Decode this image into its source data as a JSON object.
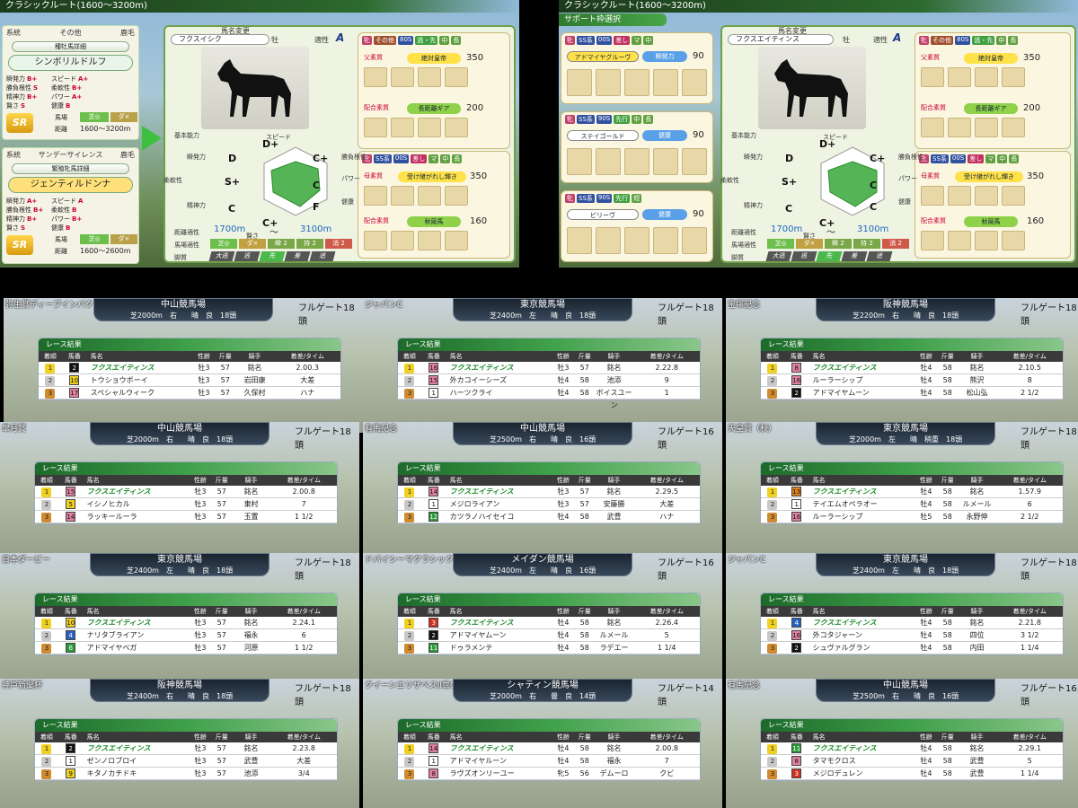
{
  "left_panel": {
    "header": "クラシックルート(1600～3200m)",
    "sire": {
      "cat1": "系統",
      "cat2": "その他",
      "coat": "鹿毛",
      "detail_btn": "種牡馬詳細",
      "name": "シンボリルドルフ",
      "stats": [
        [
          "瞬発力",
          "B+"
        ],
        [
          "スピード",
          "A+"
        ],
        [
          "勝負根性",
          "S"
        ],
        [
          "柔軟性",
          "B+"
        ],
        [
          "精神力",
          "B+"
        ],
        [
          "パワー",
          "A+"
        ],
        [
          "賢さ",
          "S"
        ],
        [
          "健康",
          "B"
        ]
      ],
      "surface": "芝◎",
      "surface2": "ダ×",
      "distance": "1600～3200m",
      "rank": "SR"
    },
    "dam": {
      "cat1": "系統",
      "cat2": "サンデーサイレンス",
      "coat": "鹿毛",
      "detail_btn": "繁殖牝馬詳細",
      "name": "ジェンティルドンナ",
      "stats": [
        [
          "瞬発力",
          "A+"
        ],
        [
          "スピード",
          "A"
        ],
        [
          "勝負根性",
          "B+"
        ],
        [
          "柔軟性",
          "B"
        ],
        [
          "精神力",
          "B+"
        ],
        [
          "パワー",
          "B+"
        ],
        [
          "賢さ",
          "S"
        ],
        [
          "健康",
          "B"
        ]
      ],
      "surface": "芝◎",
      "surface2": "ダ×",
      "distance": "1600～2600m",
      "rank": "SR"
    },
    "foal": {
      "rename": "馬名変更",
      "name": "フクスイシク",
      "sex": "牡",
      "aptitude_label": "適性",
      "aptitude": "A",
      "basic": "基本能力",
      "grades": {
        "speed": "D+",
        "guts": "C+",
        "power": "C",
        "health": "F",
        "int": "C+",
        "mind": "C",
        "flex": "S+",
        "burst": "D"
      },
      "stat_labels": {
        "speed": "スピード",
        "guts": "勝負根性",
        "power": "パワー",
        "health": "健康",
        "int": "賢さ",
        "mind": "精神力",
        "flex": "柔軟性",
        "burst": "瞬発力"
      },
      "dist_label": "距離適性",
      "dist_from": "1700m",
      "dist_sep": "～",
      "dist_to": "3100m",
      "ground_label": "馬場適性",
      "ground": [
        "芝◎",
        "ダ×",
        "瞬 2",
        "持 2",
        "消 2"
      ],
      "leg_label": "脚質",
      "legs": [
        "大逃",
        "逃",
        "先",
        "差",
        "追"
      ]
    },
    "skill_a": {
      "tags": [
        "牝",
        "その他",
        "80S",
        "逃・先",
        "中",
        "長"
      ],
      "group": "父素質",
      "skill1": "絶対皇帝",
      "pts1": "350",
      "group2": "配合素質",
      "skill2": "長距離ギア",
      "pts2": "200"
    },
    "skill_b": {
      "tags": [
        "牝",
        "SS系",
        "00S",
        "差し",
        "マ",
        "中",
        "長"
      ],
      "group": "母素質",
      "skill1": "受け継がれし輝き",
      "pts1": "350",
      "group2": "配合素質",
      "skill2": "秋競馬",
      "pts2": "160"
    }
  },
  "right_panel": {
    "header": "クラシックルート(1600～3200m)",
    "sub": "サポート枠選択",
    "supports": [
      {
        "tags": [
          "牝",
          "SS系",
          "00S",
          "差し",
          "マ",
          "中"
        ],
        "name": "アドマイヤグルーヴ",
        "skill": "瞬発力",
        "pts": "90"
      },
      {
        "tags": [
          "牝",
          "SS系",
          "90S",
          "先行",
          "中",
          "長"
        ],
        "name": "ステイゴールド",
        "skill": "健康",
        "pts": "90"
      },
      {
        "tags": [
          "牝",
          "SS系",
          "90S",
          "先行",
          "短"
        ],
        "name": "ビリーヴ",
        "skill": "健康",
        "pts": "90"
      }
    ],
    "foal_name": "フクスエイティンス",
    "foal_grades": {
      "speed": "D+",
      "guts": "C+",
      "power": "C",
      "health": "C",
      "int": "C+",
      "mind": "C",
      "flex": "S+",
      "burst": "D"
    },
    "dist_from": "1700m",
    "dist_to": "3100m"
  },
  "columns": [
    "着順",
    "馬番",
    "馬名",
    "性齢",
    "斤量",
    "騎手",
    "着差/タイム"
  ],
  "result_header": "レース結果",
  "races": [
    {
      "title": "弥生賞ディープインパクト記念",
      "track": "中山競馬場",
      "info": "芝2000m　右　　晴　良　18頭",
      "gate": "フルゲート18頭",
      "rows": [
        [
          "1",
          "2",
          "フクスエイティンス",
          "牡3",
          "57",
          "銘名",
          "2.00.3"
        ],
        [
          "2",
          "10",
          "トウショウボーイ",
          "牡3",
          "57",
          "岩田康",
          "大差"
        ],
        [
          "3",
          "17",
          "スペシャルウィーク",
          "牡3",
          "57",
          "久保村",
          "ハナ"
        ]
      ]
    },
    {
      "title": "ジャパンC",
      "track": "東京競馬場",
      "info": "芝2400m　左　　晴　良　18頭",
      "gate": "フルゲート18頭",
      "rows": [
        [
          "1",
          "16",
          "フクスエイティンス",
          "牡3",
          "57",
          "銘名",
          "2.22.8"
        ],
        [
          "2",
          "15",
          "外カコイーシーズ",
          "牡4",
          "58",
          "池添",
          "9"
        ],
        [
          "3",
          "1",
          "ハーツクライ",
          "牡4",
          "58",
          "ボイスユーン",
          "1"
        ]
      ]
    },
    {
      "title": "宝塚記念",
      "track": "阪神競馬場",
      "info": "芝2200m　右　　晴　良　18頭",
      "gate": "フルゲート18頭",
      "rows": [
        [
          "1",
          "8",
          "フクスエイティンス",
          "牡4",
          "58",
          "銘名",
          "2.10.5"
        ],
        [
          "2",
          "16",
          "ルーラーシップ",
          "牡4",
          "58",
          "熊沢",
          "8"
        ],
        [
          "3",
          "2",
          "アドマイヤムーン",
          "牡4",
          "58",
          "松山弘",
          "2 1/2"
        ]
      ]
    },
    {
      "title": "皐月賞",
      "track": "中山競馬場",
      "info": "芝2000m　右　　晴　良　18頭",
      "gate": "フルゲート18頭",
      "rows": [
        [
          "1",
          "15",
          "フクスエイティンス",
          "牡3",
          "57",
          "銘名",
          "2.00.8"
        ],
        [
          "2",
          "5",
          "イシノヒカル",
          "牡3",
          "57",
          "東村",
          "7"
        ],
        [
          "3",
          "14",
          "ラッキールーラ",
          "牡3",
          "57",
          "玉置",
          "1 1/2"
        ]
      ]
    },
    {
      "title": "有馬記念",
      "track": "中山競馬場",
      "info": "芝2500m　右　　晴　良　16頭",
      "gate": "フルゲート16頭",
      "rows": [
        [
          "1",
          "14",
          "フクスエイティンス",
          "牡3",
          "57",
          "銘名",
          "2.29.5"
        ],
        [
          "2",
          "1",
          "メジロライアン",
          "牡3",
          "57",
          "安藤勝",
          "大差"
        ],
        [
          "3",
          "12",
          "カツラノハイセイコ",
          "牡4",
          "58",
          "武豊",
          "ハナ"
        ]
      ]
    },
    {
      "title": "天皇賞（秋）",
      "track": "東京競馬場",
      "info": "芝2000m　左　　晴　稍重　18頭",
      "gate": "フルゲート18頭",
      "rows": [
        [
          "1",
          "13",
          "フクスエイティンス",
          "牡4",
          "58",
          "銘名",
          "1.57.9"
        ],
        [
          "2",
          "1",
          "テイエムオペラオー",
          "牡4",
          "58",
          "ルメール",
          "6"
        ],
        [
          "3",
          "16",
          "ルーラーシップ",
          "牡5",
          "58",
          "永野伸",
          "2 1/2"
        ]
      ]
    },
    {
      "title": "日本ダービー",
      "track": "東京競馬場",
      "info": "芝2400m　左　　晴　良　18頭",
      "gate": "フルゲート18頭",
      "rows": [
        [
          "1",
          "10",
          "フクスエイティンス",
          "牡3",
          "57",
          "銘名",
          "2.24.1"
        ],
        [
          "2",
          "4",
          "ナリタブライアン",
          "牡3",
          "57",
          "福永",
          "6"
        ],
        [
          "3",
          "6",
          "アドマイヤベガ",
          "牡3",
          "57",
          "河原",
          "1 1/2"
        ]
      ]
    },
    {
      "title": "ドバイシーマクラシック",
      "track": "メイダン競馬場",
      "info": "芝2400m　左　　晴　良　16頭",
      "gate": "フルゲート16頭",
      "rows": [
        [
          "1",
          "3",
          "フクスエイティンス",
          "牡4",
          "58",
          "銘名",
          "2.26.4"
        ],
        [
          "2",
          "2",
          "アドマイヤムーン",
          "牡4",
          "58",
          "ルメール",
          "5"
        ],
        [
          "3",
          "11",
          "ドゥラメンテ",
          "牡4",
          "58",
          "ラデエー",
          "1 1/4"
        ]
      ]
    },
    {
      "title": "ジャパンC",
      "track": "東京競馬場",
      "info": "芝2400m　左　　晴　良　18頭",
      "gate": "フルゲート18頭",
      "rows": [
        [
          "1",
          "4",
          "フクスエイティンス",
          "牡4",
          "58",
          "銘名",
          "2.21.8"
        ],
        [
          "2",
          "16",
          "外コタジャーン",
          "牡4",
          "58",
          "四位",
          "3 1/2"
        ],
        [
          "3",
          "2",
          "シュヴァルグラン",
          "牡4",
          "58",
          "内田",
          "1 1/4"
        ]
      ]
    },
    {
      "title": "神戸新聞杯",
      "track": "阪神競馬場",
      "info": "芝2400m　右　　晴　良　18頭",
      "gate": "フルゲート18頭",
      "rows": [
        [
          "1",
          "2",
          "フクスエイティンス",
          "牡3",
          "57",
          "銘名",
          "2.23.8"
        ],
        [
          "2",
          "1",
          "ゼンノロブロイ",
          "牡3",
          "57",
          "武豊",
          "大差"
        ],
        [
          "3",
          "9",
          "キタノカチドキ",
          "牡3",
          "57",
          "池添",
          "3/4"
        ]
      ]
    },
    {
      "title": "クイーンエリザベスII世C",
      "track": "シャティン競馬場",
      "info": "芝2000m　右　　曇　良　14頭",
      "gate": "フルゲート14頭",
      "rows": [
        [
          "1",
          "14",
          "フクスエイティンス",
          "牡4",
          "58",
          "銘名",
          "2.00.8"
        ],
        [
          "2",
          "1",
          "アドマイヤルーン",
          "牡4",
          "58",
          "福永",
          "7"
        ],
        [
          "3",
          "8",
          "ラヴズオンリーユー",
          "牝5",
          "56",
          "デムーロ",
          "クビ"
        ]
      ]
    },
    {
      "title": "有馬記念",
      "track": "中山競馬場",
      "info": "芝2500m　右　　晴　良　16頭",
      "gate": "フルゲート16頭",
      "rows": [
        [
          "1",
          "11",
          "フクスエイティンス",
          "牡4",
          "58",
          "銘名",
          "2.29.1"
        ],
        [
          "2",
          "8",
          "タマモクロス",
          "牡4",
          "58",
          "武豊",
          "5"
        ],
        [
          "3",
          "3",
          "メジロデュレン",
          "牡4",
          "58",
          "武豊",
          "1 1/4"
        ]
      ]
    }
  ]
}
